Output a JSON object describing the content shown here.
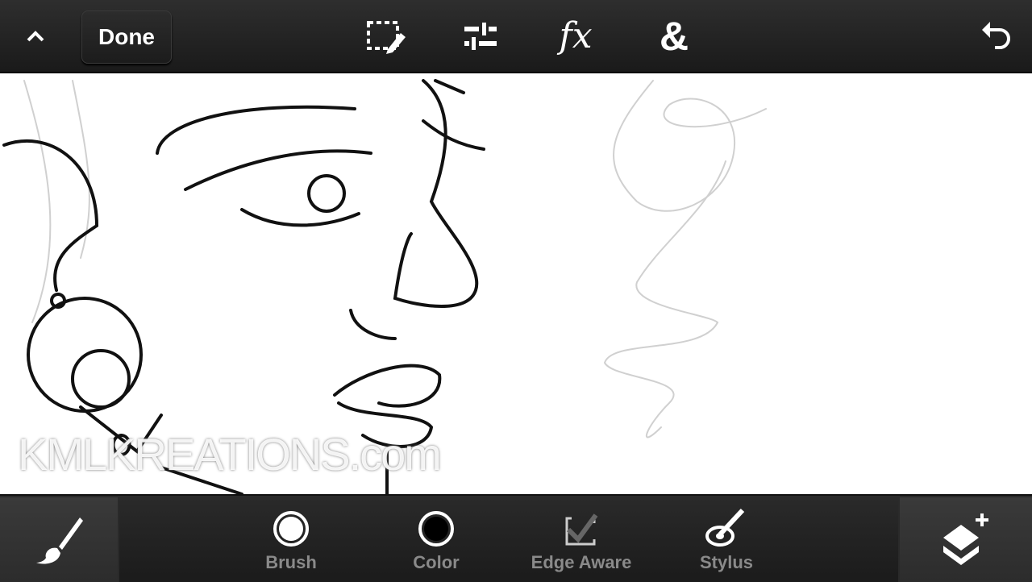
{
  "topbar": {
    "collapse_icon": "chevron-up-icon",
    "done_label": "Done",
    "tools": [
      "selection-edit-icon",
      "adjustments-icon",
      "fx-icon",
      "ampersand-icon"
    ],
    "fx_label": "fx",
    "amp_label": "&",
    "undo_icon": "undo-icon"
  },
  "canvas": {
    "watermark": "KMLKREATIONS.com"
  },
  "bottombar": {
    "brush_tool_icon": "paintbrush-icon",
    "tools": [
      {
        "label": "Brush",
        "icon": "brush-size-circle-icon"
      },
      {
        "label": "Color",
        "icon": "color-swatch-icon",
        "color": "#000000"
      },
      {
        "label": "Edge Aware",
        "icon": "checkbox-icon"
      },
      {
        "label": "Stylus",
        "icon": "stylus-icon"
      }
    ],
    "layers_icon": "add-layer-icon"
  }
}
